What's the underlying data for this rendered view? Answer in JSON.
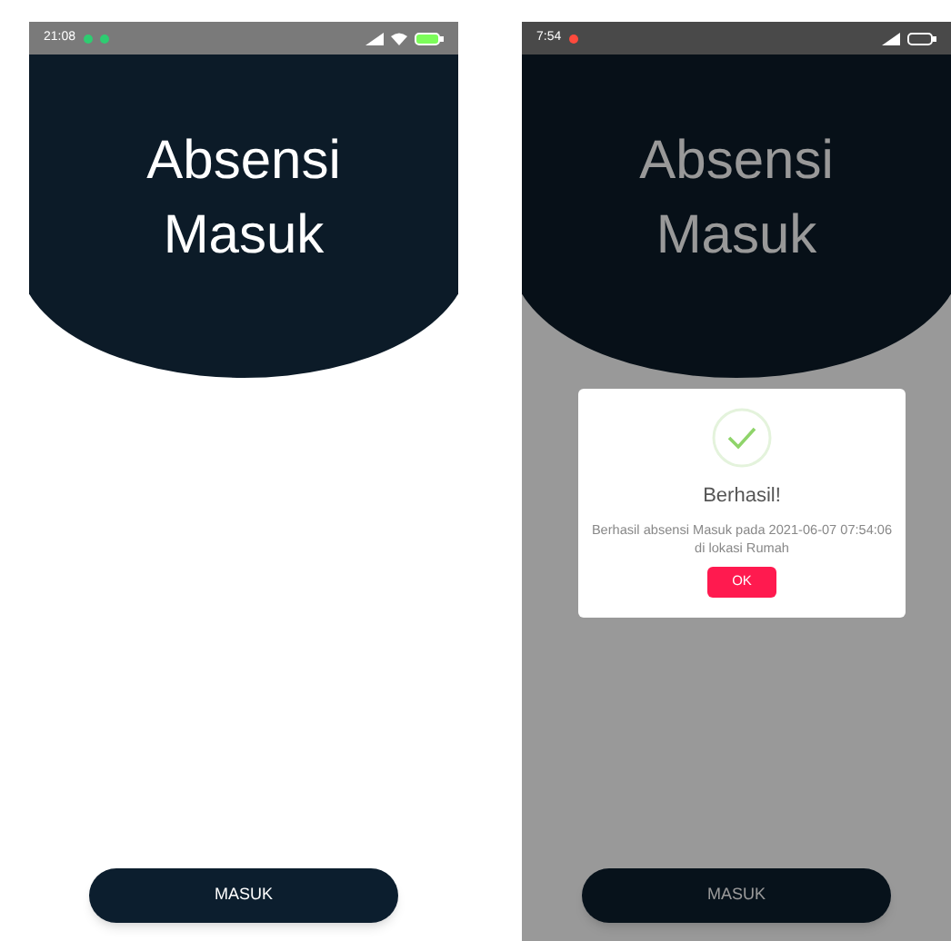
{
  "screens": [
    {
      "status_bar": {
        "time": "21:08",
        "notification_dots": [
          {
            "color": "#2ecc71"
          },
          {
            "color": "#2ecc71"
          }
        ],
        "wifi": true
      },
      "header": {
        "title_lines": [
          "Absensi",
          "Masuk"
        ]
      },
      "button": {
        "label": "MASUK"
      },
      "dimmed": false
    },
    {
      "status_bar": {
        "time": "7:54",
        "notification_dots": [
          {
            "color": "#ff4a3d"
          }
        ],
        "wifi": false
      },
      "header": {
        "title_lines": [
          "Absensi",
          "Masuk"
        ]
      },
      "button": {
        "label": "MASUK"
      },
      "dimmed": true,
      "dialog": {
        "title": "Berhasil!",
        "message": "Berhasil absensi Masuk pada 2021-06-07 07:54:06 di lokasi Rumah",
        "button": "OK"
      }
    }
  ]
}
